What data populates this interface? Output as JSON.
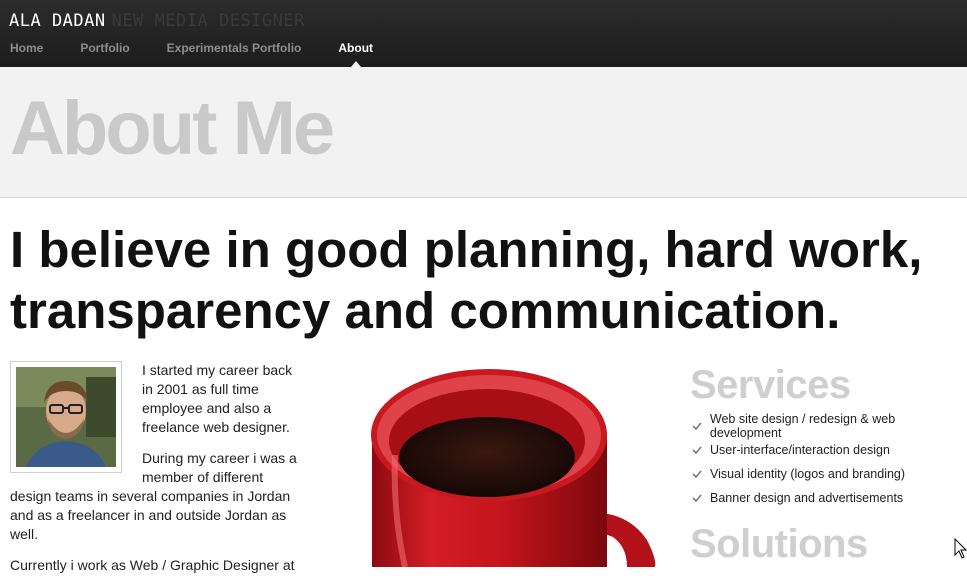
{
  "header": {
    "brand_name": "ALA DADAN",
    "brand_tagline": "NEW MEDIA DESIGNER",
    "nav": [
      {
        "label": "Home"
      },
      {
        "label": "Portfolio"
      },
      {
        "label": "Experimentals Portfolio"
      },
      {
        "label": "About"
      }
    ],
    "active_nav": "About"
  },
  "page": {
    "title": "About Me",
    "tagline": "I believe in good planning, hard work, transparency and communication."
  },
  "bio": {
    "paragraphs": [
      "I started my career back in 2001 as full time employee and also a freelance web designer.",
      "During my career i was a member of different design teams in several companies in Jordan and as a freelancer in and outside Jordan as well.",
      "Currently i work as Web / Graphic Designer at"
    ]
  },
  "services": {
    "heading": "Services",
    "items": [
      "Web site design / redesign & web development",
      "User-interface/interaction design",
      "Visual identity (logos and branding)",
      "Banner design and advertisements"
    ]
  },
  "solutions": {
    "heading": "Solutions"
  },
  "colors": {
    "header_bg": "#222222",
    "title_band_bg": "#f2f2f2",
    "heading_gray": "#cfcfcf",
    "mug_red": "#c4141c"
  }
}
